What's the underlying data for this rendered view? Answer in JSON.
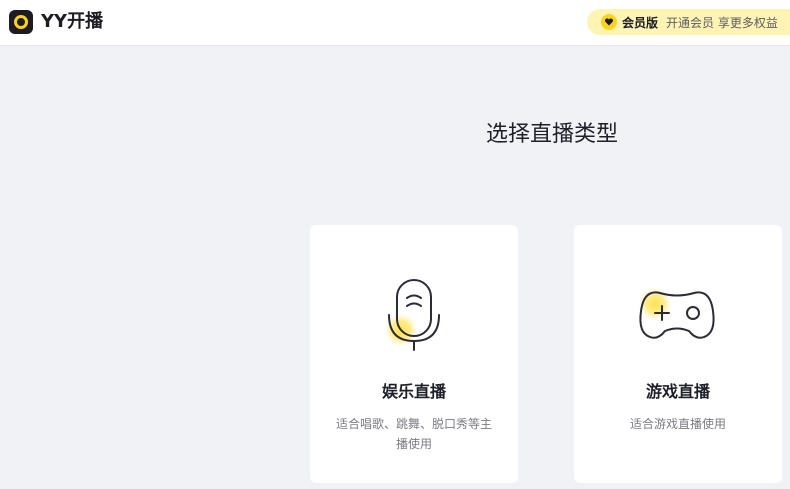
{
  "app": {
    "title": "YY开播"
  },
  "vip": {
    "label": "会员版",
    "desc": "开通会员 享更多权益"
  },
  "main": {
    "heading": "选择直播类型",
    "cards": [
      {
        "title": "娱乐直播",
        "desc": "适合唱歌、跳舞、脱口秀等主播使用",
        "icon": "microphone-icon"
      },
      {
        "title": "游戏直播",
        "desc": "适合游戏直播使用",
        "icon": "gamepad-icon"
      }
    ]
  },
  "colors": {
    "accent": "#ffd21f",
    "pill": "#fff4b3",
    "bg": "#f1f2f6"
  }
}
